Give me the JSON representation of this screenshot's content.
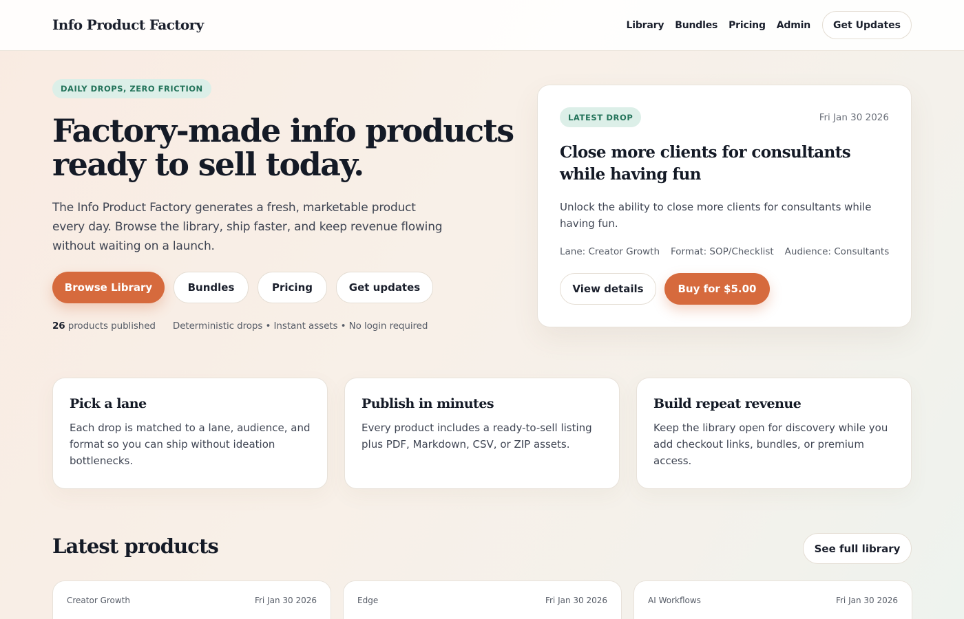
{
  "nav": {
    "brand": "Info Product Factory",
    "links": [
      "Library",
      "Bundles",
      "Pricing",
      "Admin"
    ],
    "cta": "Get Updates"
  },
  "hero": {
    "tag": "DAILY DROPS, ZERO FRICTION",
    "title": "Factory-made info products ready to sell today.",
    "subtitle": "The Info Product Factory generates a fresh, marketable product every day. Browse the library, ship faster, and keep revenue flowing without waiting on a launch.",
    "buttons": {
      "primary": "Browse Library",
      "bundles": "Bundles",
      "pricing": "Pricing",
      "updates": "Get updates"
    },
    "stats": {
      "count": "26",
      "count_label": "products published",
      "tagline": "Deterministic drops • Instant assets • No login required"
    }
  },
  "latest_drop": {
    "badge": "LATEST DROP",
    "date": "Fri Jan 30 2026",
    "title": "Close more clients for consultants while having fun",
    "description": "Unlock the ability to close more clients for consultants while having fun.",
    "meta": {
      "lane": "Lane: Creator Growth",
      "format": "Format: SOP/Checklist",
      "audience": "Audience: Consultants"
    },
    "view_label": "View details",
    "buy_label": "Buy for $5.00"
  },
  "features": [
    {
      "title": "Pick a lane",
      "text": "Each drop is matched to a lane, audience, and format so you can ship without ideation bottlenecks."
    },
    {
      "title": "Publish in minutes",
      "text": "Every product includes a ready-to-sell listing plus PDF, Markdown, CSV, or ZIP assets."
    },
    {
      "title": "Build repeat revenue",
      "text": "Keep the library open for discovery while you add checkout links, bundles, or premium access."
    }
  ],
  "latest_products": {
    "title": "Latest products",
    "see_full": "See full library",
    "items": [
      {
        "lane": "Creator Growth",
        "date": "Fri Jan 30 2026"
      },
      {
        "lane": "Edge",
        "date": "Fri Jan 30 2026"
      },
      {
        "lane": "AI Workflows",
        "date": "Fri Jan 30 2026"
      }
    ]
  },
  "colors": {
    "accent": "#d66a3d",
    "tag_bg": "#dcefe8",
    "tag_text": "#23735a",
    "ink": "#141a26"
  }
}
